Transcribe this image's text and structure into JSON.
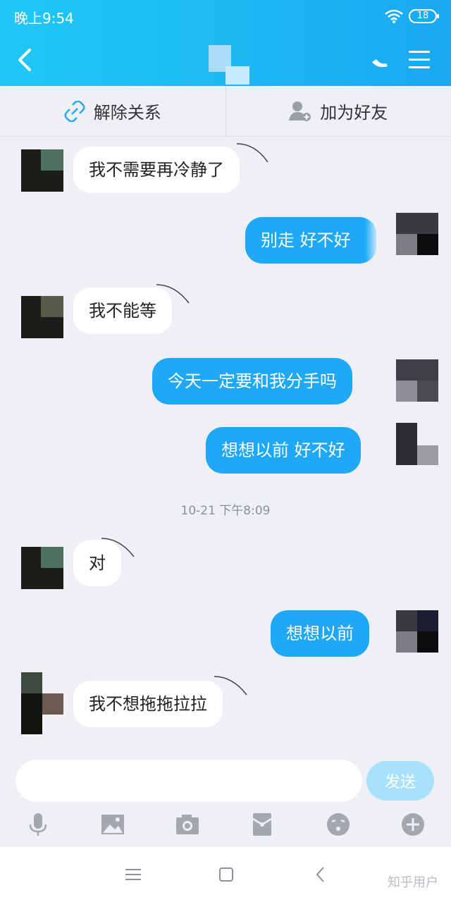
{
  "status": {
    "time": "晚上9:54",
    "battery": "18"
  },
  "actions": {
    "unlink": "解除关系",
    "add_friend": "加为好友"
  },
  "messages": [
    {
      "dir": "in",
      "text": "我不需要再冷静了"
    },
    {
      "dir": "out",
      "text": "别走 好不好"
    },
    {
      "dir": "in",
      "text": "我不能等"
    },
    {
      "dir": "out",
      "text": "今天一定要和我分手吗"
    },
    {
      "dir": "out",
      "text": "想想以前 好不好"
    },
    {
      "dir": "in",
      "text": "对"
    },
    {
      "dir": "out",
      "text": "想想以前"
    },
    {
      "dir": "in",
      "text": "我不想拖拖拉拉"
    }
  ],
  "timestamp": "10-21 下午8:09",
  "input": {
    "placeholder": "",
    "send_label": "发送"
  },
  "watermark": "知乎用户",
  "colors": {
    "header": "#1ab4f5",
    "outgoing_bubble": "#1ea8f5",
    "incoming_bubble": "#ffffff",
    "background": "#eef0f5"
  }
}
